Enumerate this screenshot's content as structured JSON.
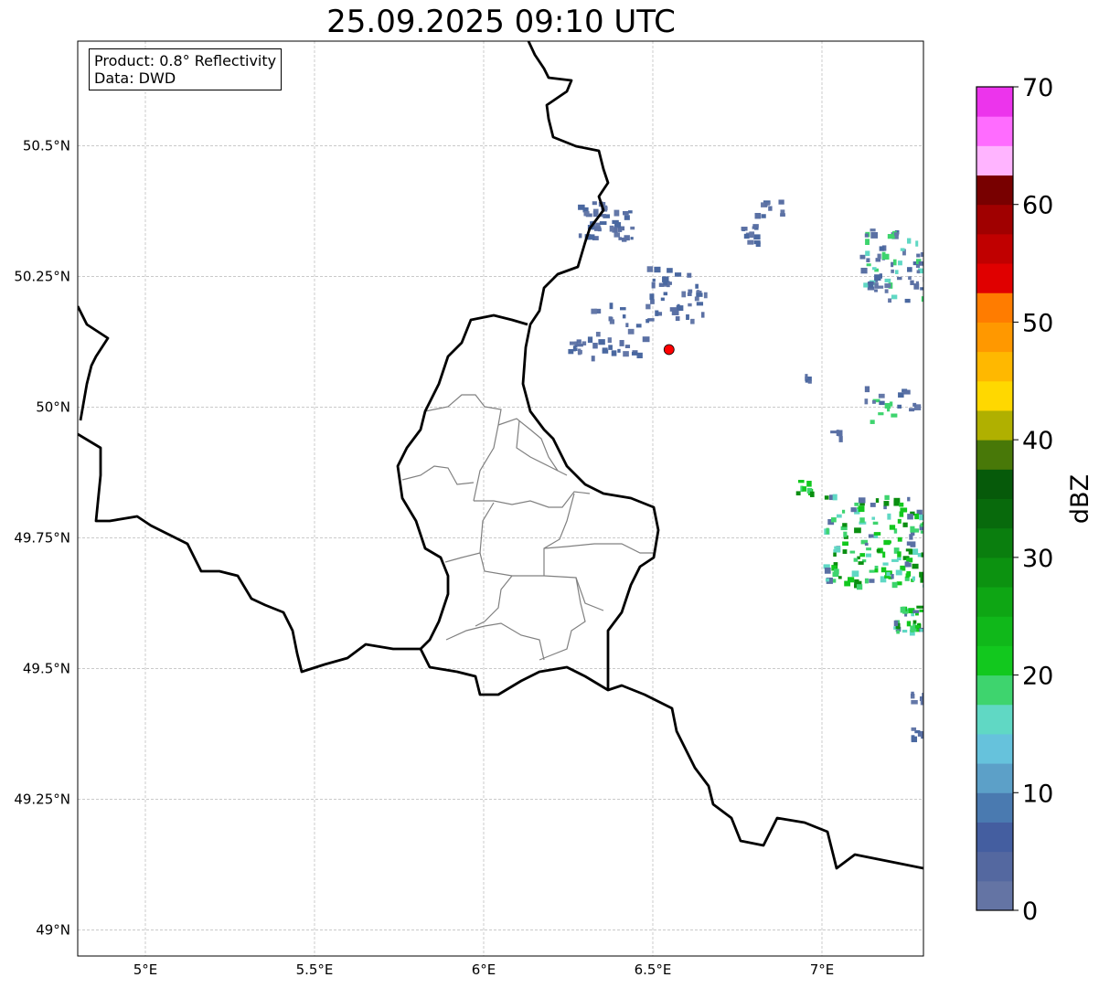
{
  "title": "25.09.2025 09:10 UTC",
  "legend": {
    "product": "Product: 0.8° Reflectivity",
    "data": "Data: DWD"
  },
  "map": {
    "lon_range": [
      4.8,
      7.3
    ],
    "lat_range": [
      48.95,
      50.7
    ],
    "lon_ticks": [
      {
        "v": 5,
        "label": "5°E"
      },
      {
        "v": 5.5,
        "label": "5.5°E"
      },
      {
        "v": 6,
        "label": "6°E"
      },
      {
        "v": 6.5,
        "label": "6.5°E"
      },
      {
        "v": 7,
        "label": "7°E"
      }
    ],
    "lat_ticks": [
      {
        "v": 50.5,
        "label": "50.5°N"
      },
      {
        "v": 50.25,
        "label": "50.25°N"
      },
      {
        "v": 50,
        "label": "50°N"
      },
      {
        "v": 49.75,
        "label": "49.75°N"
      },
      {
        "v": 49.5,
        "label": "49.5°N"
      },
      {
        "v": 49.25,
        "label": "49.25°N"
      },
      {
        "v": 49,
        "label": "49°N"
      }
    ],
    "radar_site": {
      "lon": 6.548,
      "lat": 50.11,
      "color": "#ff0000"
    }
  },
  "colorbar": {
    "label": "dBZ",
    "min": 0,
    "max": 70,
    "ticks": [
      {
        "v": 0,
        "label": "0"
      },
      {
        "v": 10,
        "label": "10"
      },
      {
        "v": 20,
        "label": "20"
      },
      {
        "v": 30,
        "label": "30"
      },
      {
        "v": 40,
        "label": "40"
      },
      {
        "v": 50,
        "label": "50"
      },
      {
        "v": 60,
        "label": "60"
      },
      {
        "v": 70,
        "label": "70"
      }
    ],
    "colors": [
      "#6474a4",
      "#5468a0",
      "#445ea0",
      "#4a7ab0",
      "#5ca0c8",
      "#66c2dc",
      "#60d8c4",
      "#3ed46e",
      "#12c81e",
      "#10b81a",
      "#0ea614",
      "#0c9210",
      "#0a7e0e",
      "#086a0c",
      "#065a0a",
      "#487808",
      "#b0b000",
      "#ffd800",
      "#ffb800",
      "#ff9800",
      "#ff7c00",
      "#e00000",
      "#c00000",
      "#a00000",
      "#780000",
      "#ffe0ff",
      "#ffb4ff",
      "#ff6cff",
      "#ec34ec"
    ]
  }
}
